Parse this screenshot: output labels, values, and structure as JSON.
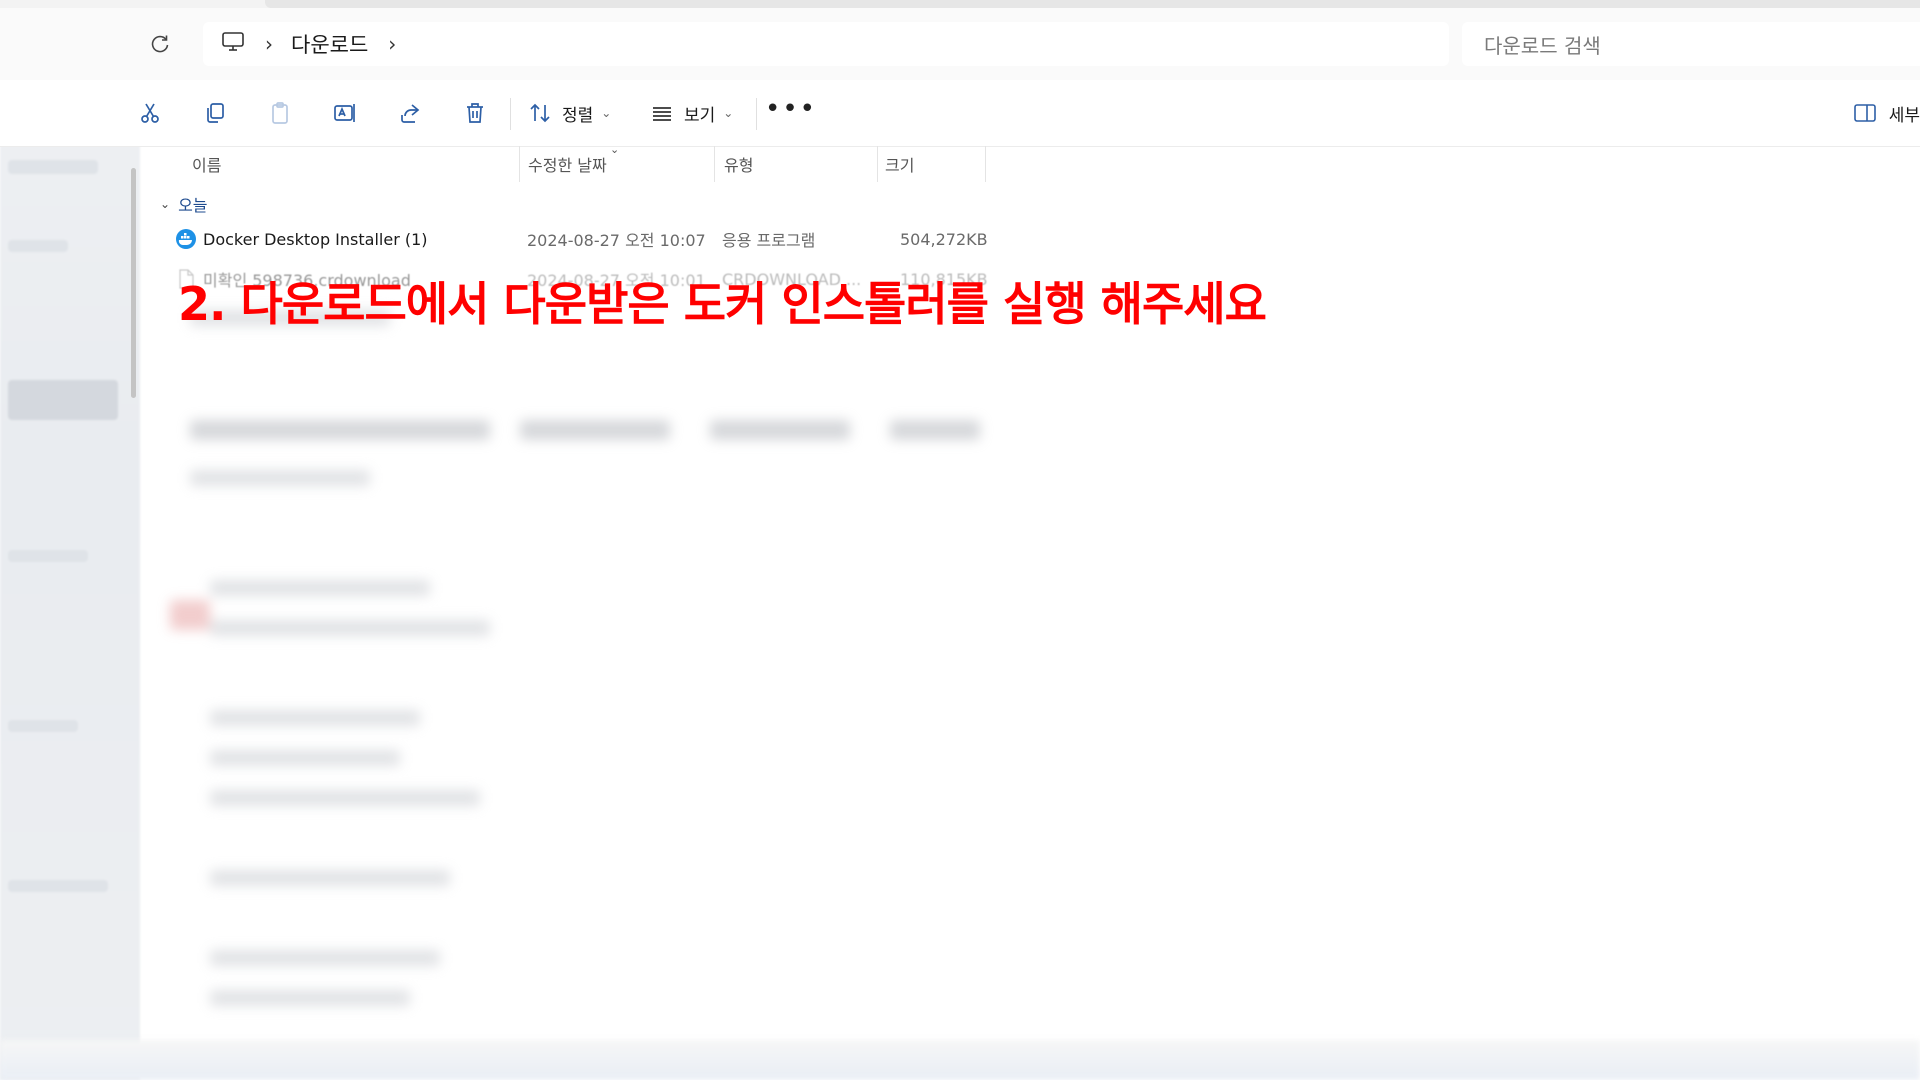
{
  "address_bar": {
    "breadcrumb": [
      "다운로드"
    ],
    "search_placeholder": "다운로드 검색"
  },
  "command_bar": {
    "sort_label": "정렬",
    "view_label": "보기",
    "more_label": "•••",
    "details_label": "세부"
  },
  "columns": {
    "name": "이름",
    "modified": "수정한 날짜",
    "type": "유형",
    "size": "크기"
  },
  "group": {
    "label": "오늘"
  },
  "files": [
    {
      "name": "Docker Desktop Installer (1)",
      "modified": "2024-08-27 오전 10:07",
      "type": "응용 프로그램",
      "size": "504,272KB",
      "icon": "docker-icon"
    },
    {
      "name": "미확인 598736.crdownload",
      "modified": "2024-08-27 오전 10:01",
      "type": "CRDOWNLOAD ...",
      "size": "110,815KB",
      "icon": "file-icon"
    }
  ],
  "overlay": {
    "caption": "2. 다운로드에서 다운받은 도커 인스톨러를 실행 해주세요"
  },
  "colors": {
    "accent": "#2d5fa6",
    "caption": "#ff0000",
    "group_text": "#1e4b8f"
  }
}
